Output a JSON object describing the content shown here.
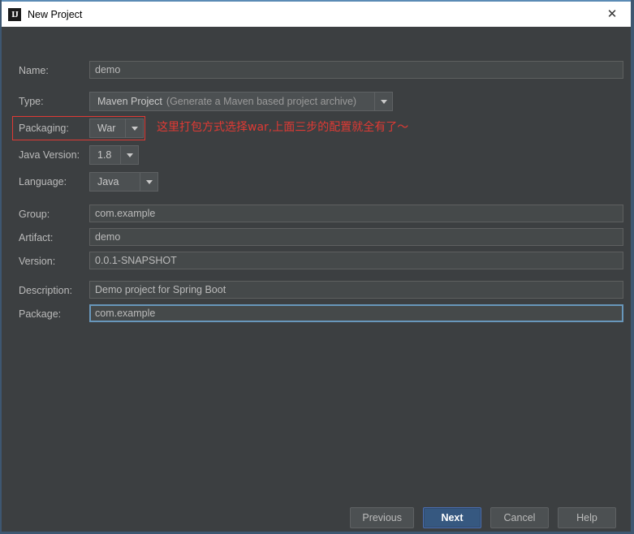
{
  "window": {
    "title": "New Project",
    "app_icon": "intellij-idea-icon",
    "close_icon": "close-icon",
    "accent_border": "#3e5771",
    "background": "#3c3f41"
  },
  "form": {
    "fields": [
      {
        "label": "Name:",
        "value": "demo",
        "kind": "text"
      },
      {
        "label": "Type:",
        "value": "Maven Project",
        "hint": "(Generate a Maven based project archive)",
        "kind": "combo"
      },
      {
        "label": "Packaging:",
        "value": "War",
        "kind": "combo"
      },
      {
        "label": "Java Version:",
        "value": "1.8",
        "kind": "combo"
      },
      {
        "label": "Language:",
        "value": "Java",
        "kind": "combo"
      },
      {
        "label": "Group:",
        "value": "com.example",
        "kind": "text"
      },
      {
        "label": "Artifact:",
        "value": "demo",
        "kind": "text"
      },
      {
        "label": "Version:",
        "value": "0.0.1-SNAPSHOT",
        "kind": "text"
      },
      {
        "label": "Description:",
        "value": "Demo project for Spring Boot",
        "kind": "text"
      },
      {
        "label": "Package:",
        "value": "com.example",
        "kind": "text",
        "focused": true
      }
    ]
  },
  "annotation": {
    "text": "这里打包方式选择war,上面三步的配置就全有了～",
    "color": "#e03a34",
    "highlight_target": "packaging-row"
  },
  "footer": {
    "buttons": [
      {
        "label": "Previous",
        "primary": false
      },
      {
        "label": "Next",
        "primary": true
      },
      {
        "label": "Cancel",
        "primary": false
      },
      {
        "label": "Help",
        "primary": false
      }
    ]
  }
}
